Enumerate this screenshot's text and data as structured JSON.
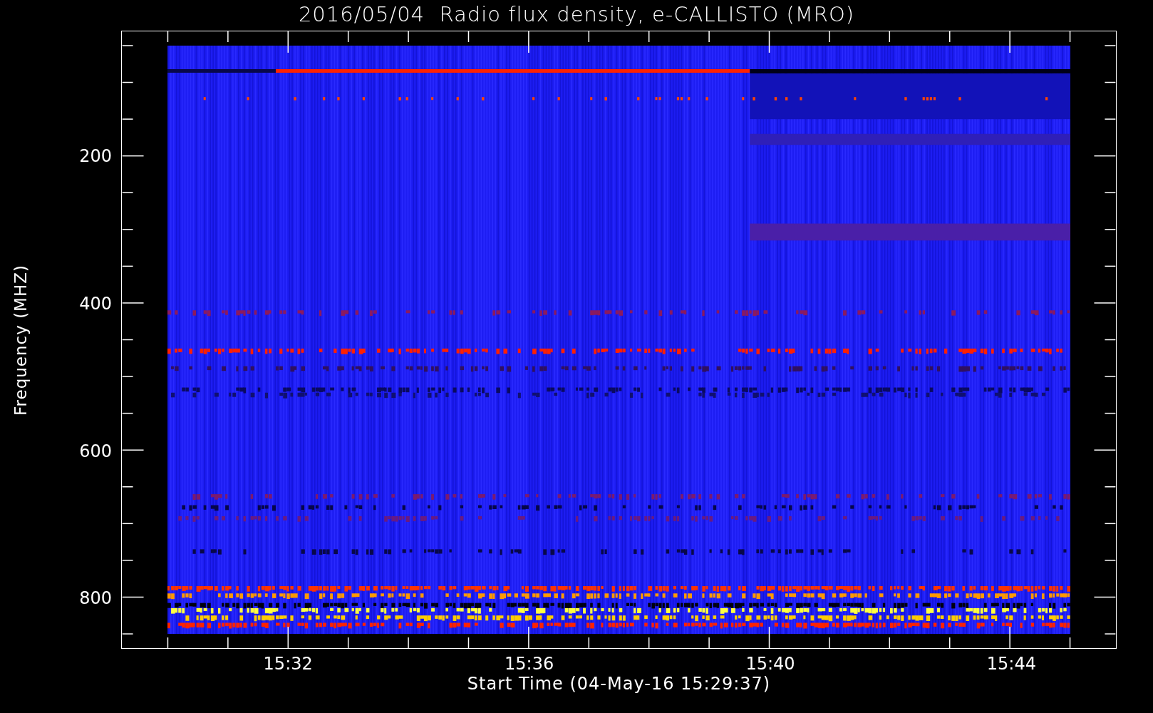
{
  "title": "2016/05/04  Radio flux density, e-CALLISTO (MRO)",
  "y_axis": {
    "label": "Frequency (MHZ)",
    "ticks": [
      {
        "label": "200"
      },
      {
        "label": "400"
      },
      {
        "label": "600"
      },
      {
        "label": "800"
      }
    ]
  },
  "x_axis": {
    "label": "Start Time (04-May-16 15:29:37)",
    "ticks": [
      {
        "label": "15:32"
      },
      {
        "label": "15:36"
      },
      {
        "label": "15:40"
      },
      {
        "label": "15:44"
      }
    ]
  }
}
